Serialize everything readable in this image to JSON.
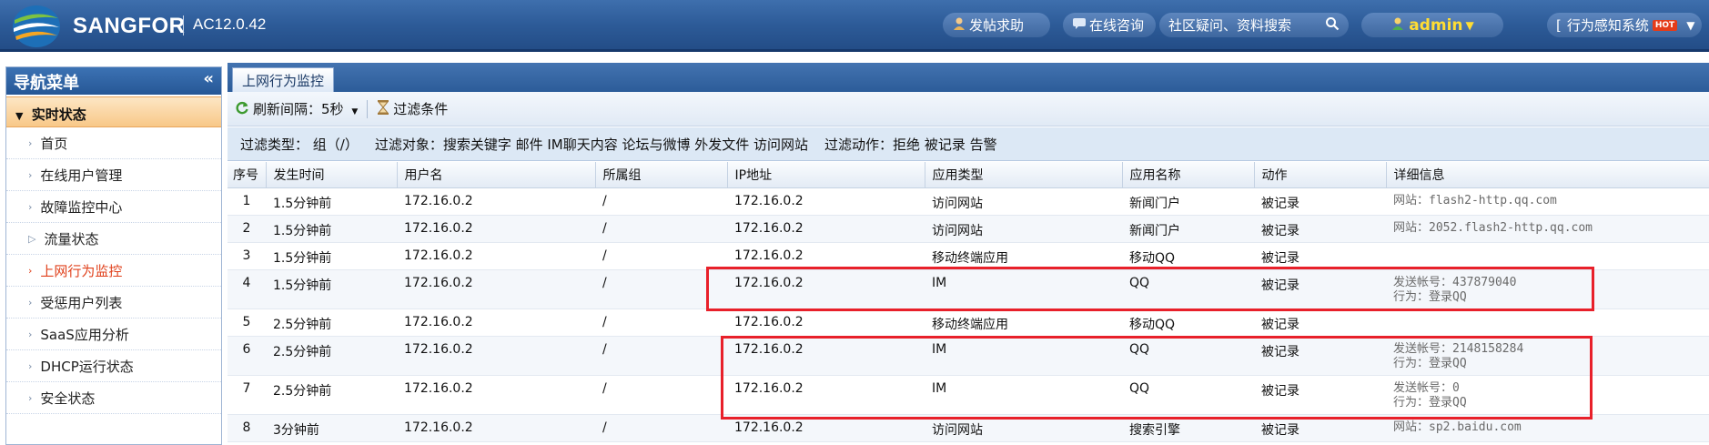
{
  "header": {
    "brand": "SANGFOR",
    "version": "AC12.0.42",
    "post_help": "发帖求助",
    "online_consult": "在线咨询",
    "search_placeholder": "社区疑问、资料搜索",
    "user": "admin",
    "system_label": "行为感知系统",
    "hot_badge": "HOT"
  },
  "sidebar": {
    "title": "导航菜单",
    "collapse_glyph": "«",
    "section": "实时状态",
    "items": [
      {
        "label": "首页"
      },
      {
        "label": "在线用户管理"
      },
      {
        "label": "故障监控中心"
      },
      {
        "label": "流量状态"
      },
      {
        "label": "上网行为监控"
      },
      {
        "label": "受惩用户列表"
      },
      {
        "label": "SaaS应用分析"
      },
      {
        "label": "DHCP运行状态"
      },
      {
        "label": "安全状态"
      }
    ]
  },
  "main": {
    "tab": "上网行为监控",
    "toolbar": {
      "refresh_label": "刷新间隔：5秒",
      "filter_label": "过滤条件"
    },
    "filter": {
      "type": "过滤类型： 组（/）",
      "object": "过滤对象：搜索关键字 邮件 IM聊天内容 论坛与微博 外发文件 访问网站",
      "action": "过滤动作：拒绝 被记录 告警"
    },
    "table": {
      "columns": [
        "序号",
        "发生时间",
        "用户名",
        "所属组",
        "IP地址",
        "应用类型",
        "应用名称",
        "动作",
        "详细信息"
      ],
      "rows": [
        {
          "no": "1",
          "time": "1.5分钟前",
          "user": "172.16.0.2",
          "group": "/",
          "ip": "172.16.0.2",
          "apptype": "访问网站",
          "appname": "新闻门户",
          "action": "被记录",
          "detail1": "网站：flash2-http.qq.com",
          "detail2": ""
        },
        {
          "no": "2",
          "time": "1.5分钟前",
          "user": "172.16.0.2",
          "group": "/",
          "ip": "172.16.0.2",
          "apptype": "访问网站",
          "appname": "新闻门户",
          "action": "被记录",
          "detail1": "网站：2052.flash2-http.qq.com",
          "detail2": ""
        },
        {
          "no": "3",
          "time": "1.5分钟前",
          "user": "172.16.0.2",
          "group": "/",
          "ip": "172.16.0.2",
          "apptype": "移动终端应用",
          "appname": "移动QQ",
          "action": "被记录",
          "detail1": "",
          "detail2": ""
        },
        {
          "no": "4",
          "time": "1.5分钟前",
          "user": "172.16.0.2",
          "group": "/",
          "ip": "172.16.0.2",
          "apptype": "IM",
          "appname": "QQ",
          "action": "被记录",
          "detail1": "发送帐号：437879040",
          "detail2": "行为：登录QQ"
        },
        {
          "no": "5",
          "time": "2.5分钟前",
          "user": "172.16.0.2",
          "group": "/",
          "ip": "172.16.0.2",
          "apptype": "移动终端应用",
          "appname": "移动QQ",
          "action": "被记录",
          "detail1": "",
          "detail2": ""
        },
        {
          "no": "6",
          "time": "2.5分钟前",
          "user": "172.16.0.2",
          "group": "/",
          "ip": "172.16.0.2",
          "apptype": "IM",
          "appname": "QQ",
          "action": "被记录",
          "detail1": "发送帐号：2148158284",
          "detail2": "行为：登录QQ"
        },
        {
          "no": "7",
          "time": "2.5分钟前",
          "user": "172.16.0.2",
          "group": "/",
          "ip": "172.16.0.2",
          "apptype": "IM",
          "appname": "QQ",
          "action": "被记录",
          "detail1": "发送帐号：0",
          "detail2": "行为：登录QQ"
        },
        {
          "no": "8",
          "time": "3分钟前",
          "user": "172.16.0.2",
          "group": "/",
          "ip": "172.16.0.2",
          "apptype": "访问网站",
          "appname": "搜索引擎",
          "action": "被记录",
          "detail1": "网站：sp2.baidu.com",
          "detail2": ""
        }
      ]
    }
  },
  "colors": {
    "header_blue": "#2d5b98",
    "active_menu": "#e0411c",
    "highlight_box": "#e8202a"
  }
}
